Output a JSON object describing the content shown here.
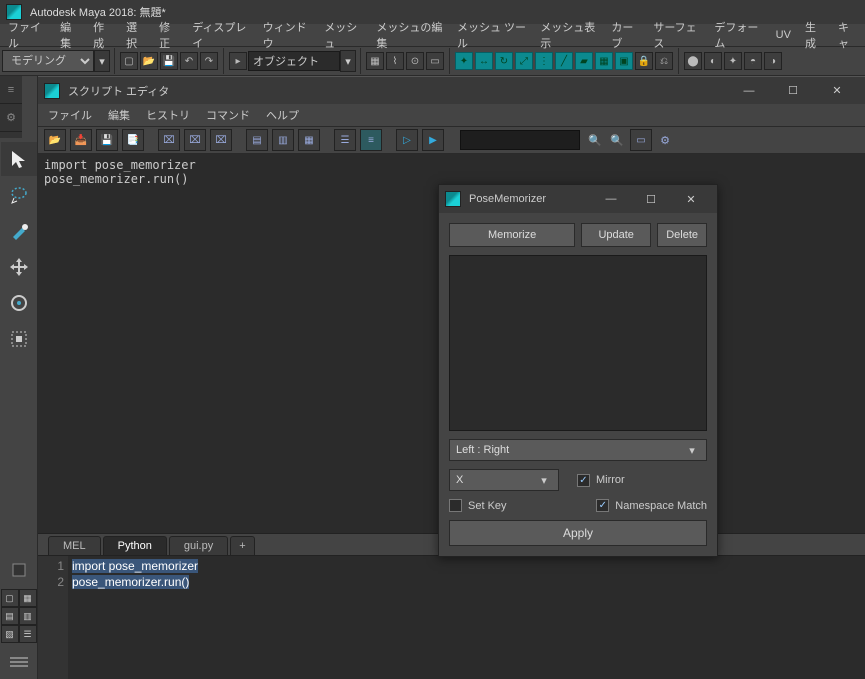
{
  "app": {
    "title": "Autodesk Maya 2018: 無題*"
  },
  "menu": [
    "ファイル",
    "編集",
    "作成",
    "選択",
    "修正",
    "ディスプレイ",
    "ウィンドウ",
    "メッシュ",
    "メッシュの編集",
    "メッシュ ツール",
    "メッシュ表示",
    "カーブ",
    "サーフェス",
    "デフォーム",
    "UV",
    "生成",
    "キャ"
  ],
  "shelf": {
    "workspace": "モデリング",
    "object_field": "オブジェクト"
  },
  "script_editor": {
    "title": "スクリプト エディタ",
    "menu": [
      "ファイル",
      "編集",
      "ヒストリ",
      "コマンド",
      "ヘルプ"
    ],
    "output": "import pose_memorizer\npose_memorizer.run()",
    "tabs": {
      "mel": "MEL",
      "python": "Python",
      "gui": "gui.py",
      "plus": "+"
    },
    "input_lines": [
      "import pose_memorizer",
      "pose_memorizer.run()"
    ]
  },
  "pm": {
    "title": "PoseMemorizer",
    "memorize": "Memorize",
    "update": "Update",
    "delete": "Delete",
    "side_sel": "Left : Right",
    "axis_sel": "X",
    "mirror": "Mirror",
    "setkey": "Set Key",
    "nsmatch": "Namespace Match",
    "apply": "Apply"
  }
}
